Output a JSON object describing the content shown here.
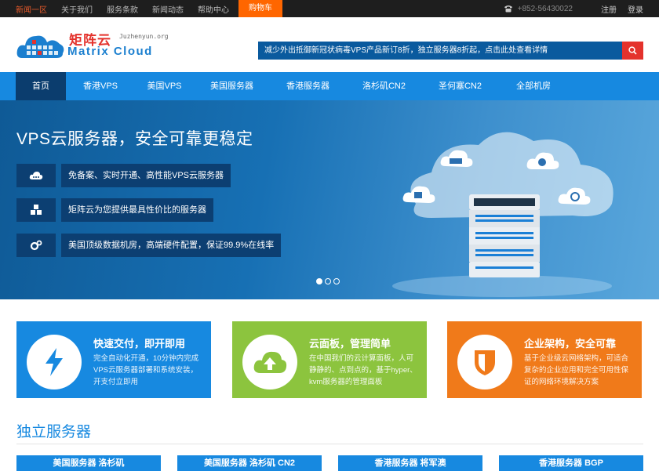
{
  "topbar": {
    "links": [
      "新闻一区",
      "关于我们",
      "服务条款",
      "新闻动态",
      "帮助中心"
    ],
    "shop": "购物车",
    "phone": "+852-56430022",
    "register": "注册",
    "login": "登录"
  },
  "header": {
    "logo_cn": "矩阵云",
    "logo_domain": "Juzhenyun.org",
    "logo_en": "Matrix Cloud",
    "search_text": "减少外出抵御新冠状病毒VPS产品新订8折，独立服务器8折起，点击此处查看详情"
  },
  "nav": {
    "items": [
      "首页",
      "香港VPS",
      "美国VPS",
      "美国服务器",
      "香港服务器",
      "洛杉矶CN2",
      "圣何塞CN2",
      "全部机房"
    ]
  },
  "banner": {
    "title": "VPS云服务器，安全可靠更稳定",
    "features": [
      {
        "icon": "cloud-icon",
        "text": "免备案、实时开通、高性能VPS云服务器"
      },
      {
        "icon": "cubes-icon",
        "text": "矩阵云为您提供最具性价比的服务器"
      },
      {
        "icon": "gears-icon",
        "text": "美国顶级数据机房，高端硬件配置，保证99.9%在线率"
      }
    ],
    "slides": 3,
    "active_slide": 0
  },
  "cards": [
    {
      "title": "快速交付，即开即用",
      "desc": "完全自动化开通，10分钟内完成VPS云服务器部署和系统安装，开支付立即用",
      "color": "#1789e0",
      "icon": "lightning-icon"
    },
    {
      "title": "云面板，管理简单",
      "desc": "在中国我们的云计算面板，人可静静的、点到点的，基于hyper、kvm服务器的管理面板",
      "color": "#8cc43e",
      "icon": "cloud-upload-icon"
    },
    {
      "title": "企业架构，安全可靠",
      "desc": "基于企业级云网络架构，可适合复杂的企业应用和完全可用性保证的网络环境解决方案",
      "color": "#f07a1a",
      "icon": "shield-icon"
    }
  ],
  "section": {
    "title": "独立服务器",
    "products": [
      "美国服务器 洛杉矶",
      "美国服务器 洛杉矶 CN2",
      "香港服务器 将军澳",
      "香港服务器 BGP"
    ]
  }
}
